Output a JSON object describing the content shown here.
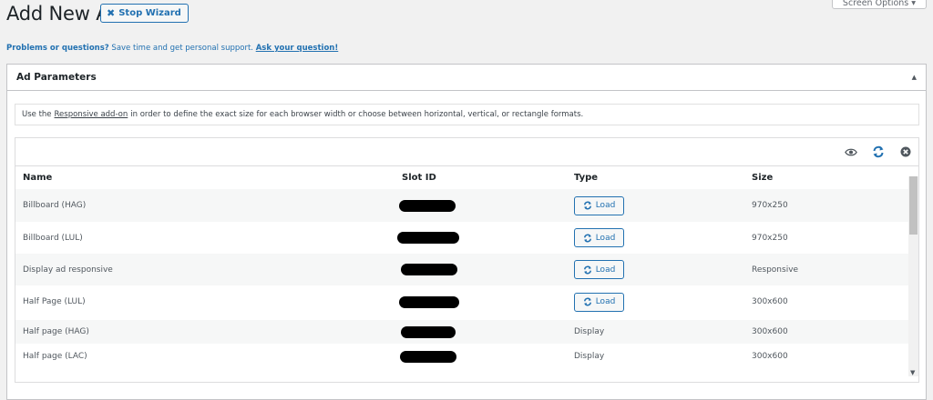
{
  "page_title": "Add New Ad",
  "stop_wizard_label": "Stop Wizard",
  "screen_options_label": "Screen Options",
  "help": {
    "prefix": "Problems or questions?",
    "middle": " Save time and get personal support. ",
    "link": "Ask your question!"
  },
  "panel": {
    "title": "Ad Parameters",
    "notice_before": "Use the",
    "notice_link": "Responsive add-on",
    "notice_after": "in order to define the exact size for each browser width or choose between horizontal, vertical, or rectangle formats."
  },
  "table": {
    "headers": {
      "name": "Name",
      "slot": "Slot ID",
      "type": "Type",
      "size": "Size"
    },
    "rows": [
      {
        "name": "Billboard (HAG)",
        "type": "Load",
        "type_is_button": true,
        "size": "970x250"
      },
      {
        "name": "Billboard (LUL)",
        "type": "Load",
        "type_is_button": true,
        "size": "970x250"
      },
      {
        "name": "Display ad responsive",
        "type": "Load",
        "type_is_button": true,
        "size": "Responsive"
      },
      {
        "name": "Half Page (LUL)",
        "type": "Load",
        "type_is_button": true,
        "size": "300x600"
      },
      {
        "name": "Half page (HAG)",
        "type": "Display",
        "type_is_button": false,
        "size": "300x600"
      },
      {
        "name": "Half page (LAC)",
        "type": "Display",
        "type_is_button": false,
        "size": "300x600"
      }
    ]
  },
  "icons": {
    "stop": "close-x-icon",
    "panel_toggle": "triangle-up-icon",
    "eye": "eye-icon",
    "refresh": "refresh-icon",
    "close": "close-circle-icon",
    "load": "refresh-icon"
  },
  "colors": {
    "accent": "#2271b1",
    "background": "#f1f1f1",
    "redaction": "#000000"
  }
}
